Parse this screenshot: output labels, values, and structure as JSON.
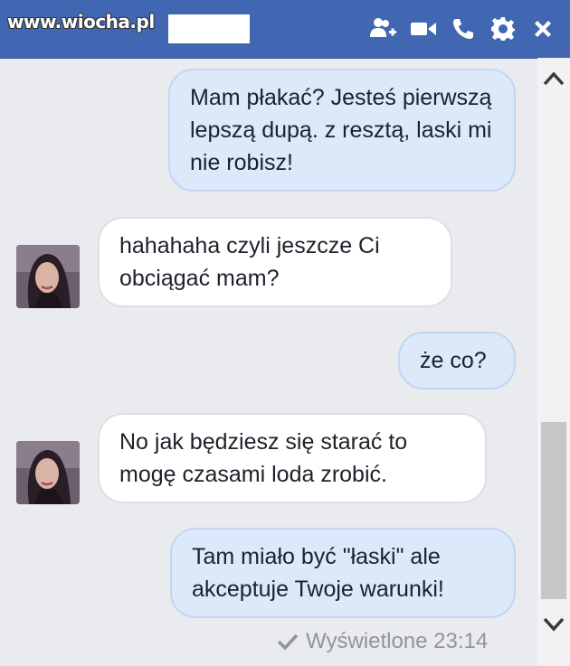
{
  "watermark": "www.wiocha.pl",
  "header": {
    "icons": [
      "add-person-icon",
      "video-call-icon",
      "phone-icon",
      "gear-icon",
      "close-icon"
    ],
    "color": "#4267b2"
  },
  "messages": [
    {
      "direction": "outgoing",
      "text": "Mam płakać? Jesteś pierwszą lepszą dupą. z resztą, laski mi nie robisz!"
    },
    {
      "direction": "incoming",
      "text": "hahahaha czyli jeszcze Ci obciągać mam?"
    },
    {
      "direction": "outgoing",
      "text": "że co?"
    },
    {
      "direction": "incoming",
      "text": "No jak będziesz się starać to mogę czasami loda zrobić."
    },
    {
      "direction": "outgoing",
      "text": "Tam miało być \"łaski\" ale akceptuje Twoje warunki!"
    }
  ],
  "status": {
    "label": "Wyświetlone 23:14",
    "icon": "check-icon"
  },
  "colors": {
    "outgoing_bubble": "#dbe9fb",
    "incoming_bubble": "#ffffff",
    "background": "#e9ebee"
  }
}
